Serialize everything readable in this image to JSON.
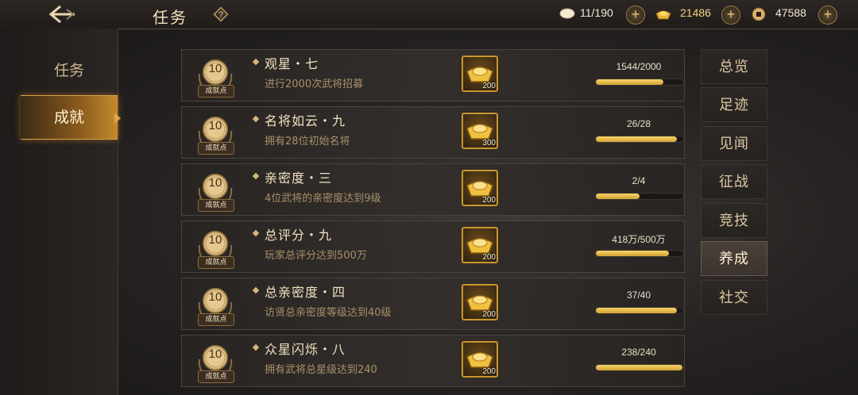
{
  "header": {
    "title": "任务",
    "help_icon": "question-diamond-icon",
    "resources": [
      {
        "icon": "stamina-egg-icon",
        "value": "11/190"
      },
      {
        "icon": "gold-ingot-icon",
        "value": "21486"
      },
      {
        "icon": "copper-coin-icon",
        "value": "47588"
      }
    ]
  },
  "left_nav": {
    "items": [
      {
        "label": "任务",
        "active": false
      },
      {
        "label": "成就",
        "active": true
      }
    ]
  },
  "achievements": [
    {
      "points": "10",
      "points_label": "成就点",
      "name": "观星・七",
      "desc": "进行2000次武将招募",
      "reward_icon": "gold-ingot-icon",
      "reward_amount": "200",
      "progress_text": "1544/2000",
      "progress": 0.772
    },
    {
      "points": "10",
      "points_label": "成就点",
      "name": "名将如云・九",
      "desc": "拥有28位初始名将",
      "reward_icon": "gold-ingot-icon",
      "reward_amount": "300",
      "progress_text": "26/28",
      "progress": 0.929
    },
    {
      "points": "10",
      "points_label": "成就点",
      "name": "亲密度・三",
      "desc": "4位武将的亲密度达到9级",
      "reward_icon": "gold-ingot-icon",
      "reward_amount": "200",
      "progress_text": "2/4",
      "progress": 0.5
    },
    {
      "points": "10",
      "points_label": "成就点",
      "name": "总评分・九",
      "desc": "玩家总评分达到500万",
      "reward_icon": "gold-ingot-icon",
      "reward_amount": "200",
      "progress_text": "418万/500万",
      "progress": 0.836
    },
    {
      "points": "10",
      "points_label": "成就点",
      "name": "总亲密度・四",
      "desc": "访贤总亲密度等级达到40级",
      "reward_icon": "gold-ingot-icon",
      "reward_amount": "200",
      "progress_text": "37/40",
      "progress": 0.925
    },
    {
      "points": "10",
      "points_label": "成就点",
      "name": "众星闪烁・八",
      "desc": "拥有武将总星级达到240",
      "reward_icon": "gold-ingot-icon",
      "reward_amount": "200",
      "progress_text": "238/240",
      "progress": 0.992
    }
  ],
  "categories": [
    {
      "label": "总览",
      "active": false
    },
    {
      "label": "足迹",
      "active": false
    },
    {
      "label": "见闻",
      "active": false
    },
    {
      "label": "征战",
      "active": false
    },
    {
      "label": "竞技",
      "active": false
    },
    {
      "label": "养成",
      "active": true
    },
    {
      "label": "社交",
      "active": false
    }
  ],
  "colors": {
    "accent_gold": "#d1a233",
    "active_tab": "#c48a2e"
  }
}
